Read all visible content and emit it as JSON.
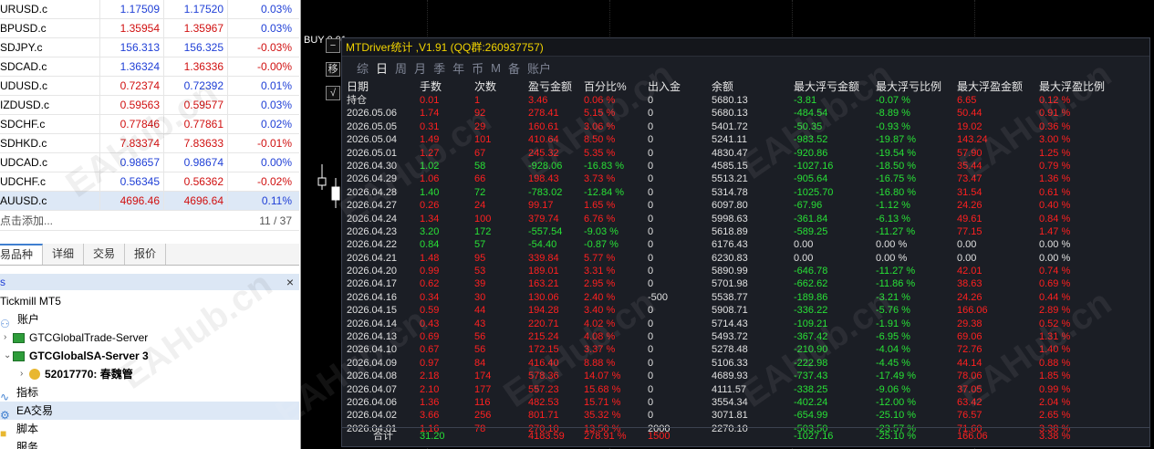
{
  "quotes": [
    {
      "symbol": "URUSD.c",
      "bid": "1.17509",
      "ask": "1.17520",
      "change": "0.03%",
      "bid_color": "blue",
      "ask_color": "blue",
      "change_color": "blue"
    },
    {
      "symbol": "BPUSD.c",
      "bid": "1.35954",
      "ask": "1.35967",
      "change": "0.03%",
      "bid_color": "red",
      "ask_color": "red",
      "change_color": "blue"
    },
    {
      "symbol": "SDJPY.c",
      "bid": "156.313",
      "ask": "156.325",
      "change": "-0.03%",
      "bid_color": "blue",
      "ask_color": "blue",
      "change_color": "red"
    },
    {
      "symbol": "SDCAD.c",
      "bid": "1.36324",
      "ask": "1.36336",
      "change": "-0.00%",
      "bid_color": "blue",
      "ask_color": "red",
      "change_color": "red"
    },
    {
      "symbol": "UDUSD.c",
      "bid": "0.72374",
      "ask": "0.72392",
      "change": "0.01%",
      "bid_color": "red",
      "ask_color": "blue",
      "change_color": "blue"
    },
    {
      "symbol": "IZDUSD.c",
      "bid": "0.59563",
      "ask": "0.59577",
      "change": "0.03%",
      "bid_color": "red",
      "ask_color": "red",
      "change_color": "blue"
    },
    {
      "symbol": "SDCHF.c",
      "bid": "0.77846",
      "ask": "0.77861",
      "change": "0.02%",
      "bid_color": "red",
      "ask_color": "red",
      "change_color": "blue"
    },
    {
      "symbol": "SDHKD.c",
      "bid": "7.83374",
      "ask": "7.83633",
      "change": "-0.01%",
      "bid_color": "red",
      "ask_color": "red",
      "change_color": "red"
    },
    {
      "symbol": "UDCAD.c",
      "bid": "0.98657",
      "ask": "0.98674",
      "change": "0.00%",
      "bid_color": "blue",
      "ask_color": "blue",
      "change_color": "blue"
    },
    {
      "symbol": "UDCHF.c",
      "bid": "0.56345",
      "ask": "0.56362",
      "change": "-0.02%",
      "bid_color": "blue",
      "ask_color": "red",
      "change_color": "red"
    },
    {
      "symbol": "AUUSD.c",
      "bid": "4696.46",
      "ask": "4696.64",
      "change": "0.11%",
      "bid_color": "red",
      "ask_color": "red",
      "change_color": "blue"
    }
  ],
  "quote_footer": {
    "add_label": "点击添加...",
    "count": "11 / 37"
  },
  "market_tabs": [
    "易品种",
    "详细",
    "交易",
    "报价"
  ],
  "navigator": {
    "header_left": "s",
    "header_close": "×",
    "broker": "Tickmill MT5",
    "accounts_label": "账户",
    "server1": "GTCGlobalTrade-Server",
    "server2": "GTCGlobalSA-Server 3",
    "account": "52017770: 春魏管",
    "indicators": "指标",
    "ea": "EA交易",
    "scripts": "脚本",
    "services": "服务"
  },
  "chart": {
    "buy_label": "BUY 0.01",
    "side_buttons": [
      "−",
      "移",
      "√"
    ]
  },
  "window": {
    "title": "MTDriver统计 ,V1.91 (QQ群:260937757)",
    "tabs": [
      "综",
      "日",
      "周",
      "月",
      "季",
      "年",
      "币",
      "M",
      "备",
      "账户"
    ],
    "active_tab": 1,
    "headers": [
      "日期",
      "手数",
      "次数",
      "盈亏金额",
      "百分比%",
      "出入金",
      "余额",
      "最大浮亏金额",
      "最大浮亏比例",
      "最大浮盈金额",
      "最大浮盈比例"
    ],
    "rows": [
      [
        "持仓",
        "0.01",
        "1",
        "3.46",
        "0.06 %",
        "0",
        "5680.13",
        "-3.81",
        "-0.07 %",
        "6.65",
        "0.12 %"
      ],
      [
        "2026.05.06",
        "1.74",
        "92",
        "278.41",
        "5.15 %",
        "0",
        "5680.13",
        "-484.54",
        "-8.89 %",
        "50.44",
        "0.91 %"
      ],
      [
        "2026.05.05",
        "0.31",
        "29",
        "160.61",
        "3.06 %",
        "0",
        "5401.72",
        "-50.35",
        "-0.93 %",
        "19.02",
        "0.36 %"
      ],
      [
        "2026.05.04",
        "1.49",
        "101",
        "410.64",
        "8.50 %",
        "0",
        "5241.11",
        "-983.52",
        "-19.87 %",
        "143.24",
        "3.00 %"
      ],
      [
        "2026.05.01",
        "1.27",
        "67",
        "245.32",
        "5.35 %",
        "0",
        "4830.47",
        "-920.86",
        "-19.54 %",
        "57.90",
        "1.25 %"
      ],
      [
        "2026.04.30",
        "1.02",
        "58",
        "-928.06",
        "-16.83 %",
        "0",
        "4585.15",
        "-1027.16",
        "-18.50 %",
        "35.44",
        "0.79 %"
      ],
      [
        "2026.04.29",
        "1.06",
        "66",
        "198.43",
        "3.73 %",
        "0",
        "5513.21",
        "-905.64",
        "-16.75 %",
        "73.47",
        "1.36 %"
      ],
      [
        "2026.04.28",
        "1.40",
        "72",
        "-783.02",
        "-12.84 %",
        "0",
        "5314.78",
        "-1025.70",
        "-16.80 %",
        "31.54",
        "0.61 %"
      ],
      [
        "2026.04.27",
        "0.26",
        "24",
        "99.17",
        "1.65 %",
        "0",
        "6097.80",
        "-67.96",
        "-1.12 %",
        "24.26",
        "0.40 %"
      ],
      [
        "2026.04.24",
        "1.34",
        "100",
        "379.74",
        "6.76 %",
        "0",
        "5998.63",
        "-361.84",
        "-6.13 %",
        "49.61",
        "0.84 %"
      ],
      [
        "2026.04.23",
        "3.20",
        "172",
        "-557.54",
        "-9.03 %",
        "0",
        "5618.89",
        "-589.25",
        "-11.27 %",
        "77.15",
        "1.47 %"
      ],
      [
        "2026.04.22",
        "0.84",
        "57",
        "-54.40",
        "-0.87 %",
        "0",
        "6176.43",
        "0.00",
        "0.00 %",
        "0.00",
        "0.00 %"
      ],
      [
        "2026.04.21",
        "1.48",
        "95",
        "339.84",
        "5.77 %",
        "0",
        "6230.83",
        "0.00",
        "0.00 %",
        "0.00",
        "0.00 %"
      ],
      [
        "2026.04.20",
        "0.99",
        "53",
        "189.01",
        "3.31 %",
        "0",
        "5890.99",
        "-646.78",
        "-11.27 %",
        "42.01",
        "0.74 %"
      ],
      [
        "2026.04.17",
        "0.62",
        "39",
        "163.21",
        "2.95 %",
        "0",
        "5701.98",
        "-662.62",
        "-11.86 %",
        "38.63",
        "0.69 %"
      ],
      [
        "2026.04.16",
        "0.34",
        "30",
        "130.06",
        "2.40 %",
        "-500",
        "5538.77",
        "-189.86",
        "-3.21 %",
        "24.26",
        "0.44 %"
      ],
      [
        "2026.04.15",
        "0.59",
        "44",
        "194.28",
        "3.40 %",
        "0",
        "5908.71",
        "-336.22",
        "-5.76 %",
        "166.06",
        "2.89 %"
      ],
      [
        "2026.04.14",
        "0.43",
        "43",
        "220.71",
        "4.02 %",
        "0",
        "5714.43",
        "-109.21",
        "-1.91 %",
        "29.38",
        "0.52 %"
      ],
      [
        "2026.04.13",
        "0.69",
        "56",
        "215.24",
        "4.08 %",
        "0",
        "5493.72",
        "-367.42",
        "-6.95 %",
        "69.06",
        "1.31 %"
      ],
      [
        "2026.04.10",
        "0.67",
        "56",
        "172.15",
        "3.37 %",
        "0",
        "5278.48",
        "-210.90",
        "-4.04 %",
        "72.76",
        "1.40 %"
      ],
      [
        "2026.04.09",
        "0.97",
        "84",
        "416.40",
        "8.88 %",
        "0",
        "5106.33",
        "-222.98",
        "-4.45 %",
        "44.14",
        "0.88 %"
      ],
      [
        "2026.04.08",
        "2.18",
        "174",
        "578.36",
        "14.07 %",
        "0",
        "4689.93",
        "-737.43",
        "-17.49 %",
        "78.06",
        "1.85 %"
      ],
      [
        "2026.04.07",
        "2.10",
        "177",
        "557.23",
        "15.68 %",
        "0",
        "4111.57",
        "-338.25",
        "-9.06 %",
        "37.05",
        "0.99 %"
      ],
      [
        "2026.04.06",
        "1.36",
        "116",
        "482.53",
        "15.71 %",
        "0",
        "3554.34",
        "-402.24",
        "-12.00 %",
        "63.42",
        "2.04 %"
      ],
      [
        "2026.04.02",
        "3.66",
        "256",
        "801.71",
        "35.32 %",
        "0",
        "3071.81",
        "-654.99",
        "-25.10 %",
        "76.57",
        "2.65 %"
      ],
      [
        "2026.04.01",
        "1.16",
        "78",
        "270.10",
        "13.50 %",
        "2000",
        "2270.10",
        "-503.50",
        "-23.57 %",
        "71.60",
        "3.38 %"
      ]
    ],
    "totals": [
      "合计",
      "31.20",
      "",
      "4183.59",
      "278.91 %",
      "1500",
      "",
      "-1027.16",
      "-25.10 %",
      "166.06",
      "3.38 %"
    ]
  },
  "watermark": "EAHub.cn",
  "colors": {
    "profit": "#ff2020",
    "loss": "#28e036",
    "title": "#f2d400",
    "quote_blue": "#1f3fd6",
    "quote_red": "#d01010"
  }
}
